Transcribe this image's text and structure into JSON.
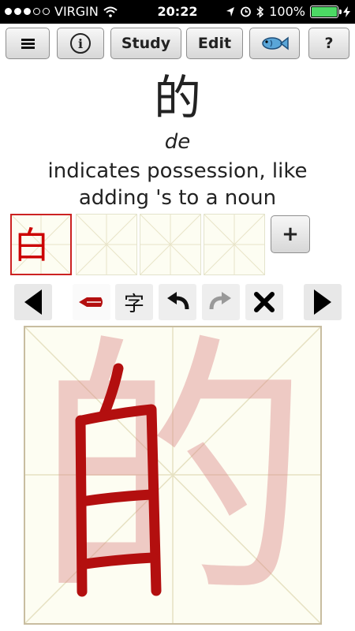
{
  "status_bar": {
    "carrier": "VIRGIN",
    "time": "20:22",
    "battery": "100%",
    "battery_level": 1.0
  },
  "toolbar": {
    "menu_icon": "hamburger-icon",
    "info_icon": "info-icon",
    "study_label": "Study",
    "edit_label": "Edit",
    "fish_icon": "fish-icon",
    "help_label": "?"
  },
  "character": {
    "hanzi": "的",
    "pinyin": "de",
    "definition": "indicates possession, like adding 's to a noun"
  },
  "thumbnails": {
    "first_char": "白",
    "add_label": "+"
  },
  "controls": {
    "prev_icon": "triangle-left-icon",
    "pen_icon": "brush-pen-icon",
    "char_label": "字",
    "undo_icon": "undo-icon",
    "redo_icon": "redo-icon",
    "clear_icon": "x-icon",
    "next_icon": "triangle-right-icon"
  },
  "canvas": {
    "ghost_char": "的",
    "stroke_color": "#b30f0f"
  }
}
